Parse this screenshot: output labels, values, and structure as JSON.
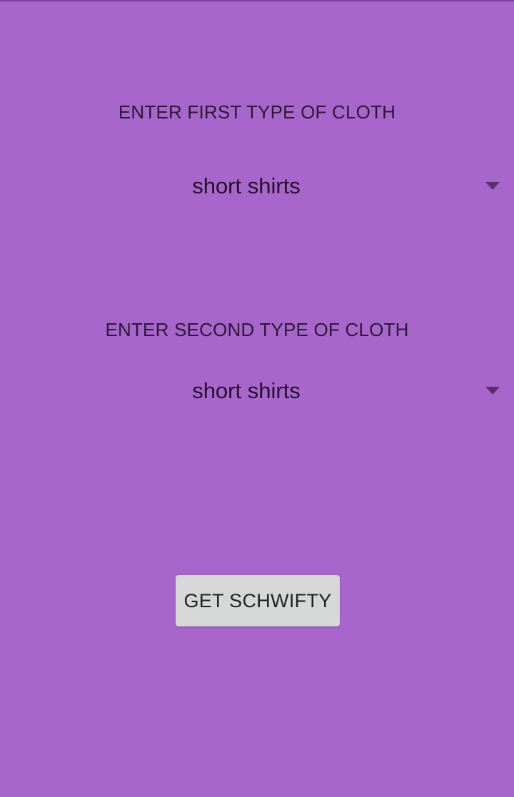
{
  "form": {
    "first_label": "ENTER FIRST TYPE OF CLOTH",
    "first_selected": "short shirts",
    "second_label": "ENTER SECOND TYPE OF CLOTH",
    "second_selected": "short shirts",
    "submit_label": "GET SCHWIFTY"
  },
  "icons": {
    "dropdown": "triangle-down-icon"
  },
  "colors": {
    "background": "#a866cc",
    "button": "#d6d7d7",
    "arrow": "#5a2f70"
  }
}
